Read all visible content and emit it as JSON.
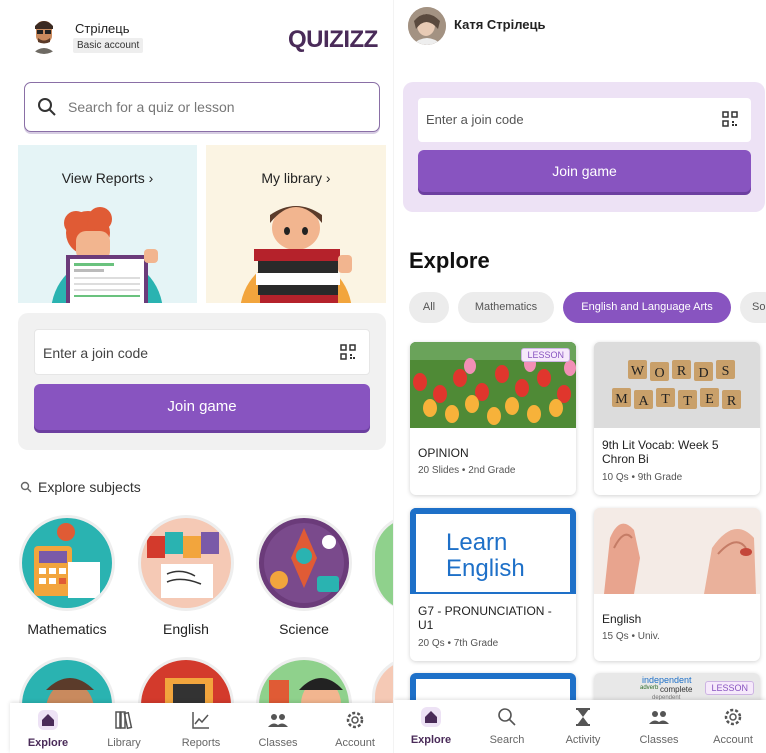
{
  "left": {
    "header": {
      "username": "Стрілець",
      "account_badge": "Basic account",
      "logo_text": "QUIZIZZ"
    },
    "search": {
      "placeholder": "Search for a quiz or lesson"
    },
    "cards": {
      "reports": "View Reports  ›",
      "library": "My library  ›"
    },
    "join": {
      "placeholder": "Enter a join code",
      "button": "Join game"
    },
    "explore_subjects": "Explore subjects",
    "subjects": [
      "Mathematics",
      "English",
      "Science"
    ],
    "nav": [
      {
        "label": "Explore",
        "icon": "home-icon",
        "active": true
      },
      {
        "label": "Library",
        "icon": "library-icon",
        "active": false
      },
      {
        "label": "Reports",
        "icon": "reports-icon",
        "active": false
      },
      {
        "label": "Classes",
        "icon": "classes-icon",
        "active": false
      },
      {
        "label": "Account",
        "icon": "gear-icon",
        "active": false
      }
    ]
  },
  "right": {
    "header": {
      "username": "Катя Стрілець"
    },
    "join": {
      "placeholder": "Enter a join code",
      "button": "Join game"
    },
    "explore_title": "Explore",
    "chips": [
      {
        "label": "All",
        "active": false
      },
      {
        "label": "Mathematics",
        "active": false
      },
      {
        "label": "English and Language Arts",
        "active": true
      },
      {
        "label": "So",
        "active": false
      }
    ],
    "quizzes": [
      {
        "title": "OPINION",
        "meta": "20 Slides • 2nd Grade",
        "tag": "LESSON",
        "thumb": "tulips"
      },
      {
        "title": "9th Lit Vocab: Week 5 Chron Bi",
        "meta": "10 Qs • 9th Grade",
        "tag": "",
        "thumb": "words-matter"
      },
      {
        "title": "G7 - PRONUNCIATION - U1",
        "meta": "20 Qs • 7th Grade",
        "tag": "",
        "thumb": "learn-english"
      },
      {
        "title": "English",
        "meta": "15 Qs • Univ.",
        "tag": "",
        "thumb": "ears"
      },
      {
        "title": "",
        "meta": "",
        "tag": "",
        "thumb": "blue"
      },
      {
        "title": "",
        "meta": "",
        "tag": "LESSON",
        "thumb": "word-cloud"
      }
    ],
    "thumb_text": {
      "words_line1": [
        "W",
        "O",
        "R",
        "D",
        "S"
      ],
      "words_line2": [
        "M",
        "A",
        "T",
        "T",
        "E",
        "R"
      ],
      "learn": "Learn",
      "english": "English",
      "cloud_words": [
        "independent",
        "adverb",
        "complete",
        "dependent"
      ]
    },
    "nav": [
      {
        "label": "Explore",
        "icon": "home-icon",
        "active": true
      },
      {
        "label": "Search",
        "icon": "search-icon",
        "active": false
      },
      {
        "label": "Activity",
        "icon": "hourglass-icon",
        "active": false
      },
      {
        "label": "Classes",
        "icon": "classes-icon",
        "active": false
      },
      {
        "label": "Account",
        "icon": "gear-icon",
        "active": false
      }
    ]
  },
  "colors": {
    "brand_purple": "#8854c0",
    "logo_purple": "#4a2b59",
    "join_panel_right": "#ede2f5",
    "join_panel_left": "#f1f1f1"
  }
}
